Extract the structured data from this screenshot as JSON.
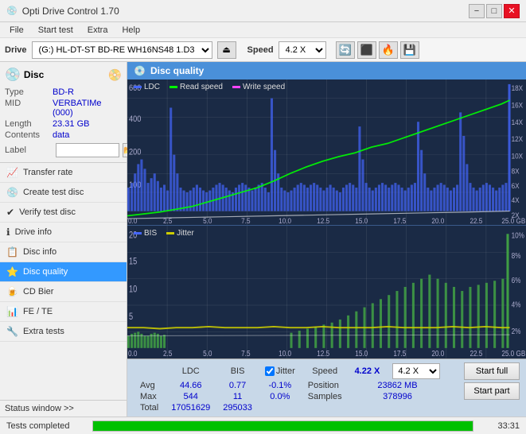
{
  "app": {
    "title": "Opti Drive Control 1.70",
    "titlebar_icon": "💿"
  },
  "titlebar": {
    "minimize": "−",
    "maximize": "□",
    "close": "✕"
  },
  "menu": {
    "items": [
      "File",
      "Start test",
      "Extra",
      "Help"
    ]
  },
  "toolbar": {
    "drive_label": "Drive",
    "drive_value": "(G:)  HL-DT-ST BD-RE  WH16NS48 1.D3",
    "speed_label": "Speed",
    "speed_value": "4.2 X"
  },
  "disc": {
    "section_title": "Disc",
    "type_label": "Type",
    "type_value": "BD-R",
    "mid_label": "MID",
    "mid_value": "VERBATIMe (000)",
    "length_label": "Length",
    "length_value": "23.31 GB",
    "contents_label": "Contents",
    "contents_value": "data",
    "label_label": "Label",
    "label_placeholder": ""
  },
  "nav": {
    "items": [
      {
        "id": "transfer-rate",
        "label": "Transfer rate",
        "icon": "📈"
      },
      {
        "id": "create-test-disc",
        "label": "Create test disc",
        "icon": "💿"
      },
      {
        "id": "verify-test-disc",
        "label": "Verify test disc",
        "icon": "✔"
      },
      {
        "id": "drive-info",
        "label": "Drive info",
        "icon": "ℹ"
      },
      {
        "id": "disc-info",
        "label": "Disc info",
        "icon": "📋"
      },
      {
        "id": "disc-quality",
        "label": "Disc quality",
        "icon": "⭐",
        "active": true
      },
      {
        "id": "cd-bier",
        "label": "CD Bier",
        "icon": "🍺"
      },
      {
        "id": "fe-te",
        "label": "FE / TE",
        "icon": "📊"
      },
      {
        "id": "extra-tests",
        "label": "Extra tests",
        "icon": "🔧"
      }
    ]
  },
  "sidebar_status": {
    "label": "Status window >>"
  },
  "disc_quality": {
    "title": "Disc quality",
    "legend": {
      "ldc": "LDC",
      "read_speed": "Read speed",
      "write_speed": "Write speed",
      "bis": "BIS",
      "jitter": "Jitter"
    },
    "chart1": {
      "y_max": 600,
      "y_right_labels": [
        "18X",
        "16X",
        "14X",
        "12X",
        "10X",
        "8X",
        "6X",
        "4X",
        "2X"
      ],
      "x_labels": [
        "0.0",
        "2.5",
        "5.0",
        "7.5",
        "10.0",
        "12.5",
        "15.0",
        "17.5",
        "20.0",
        "22.5",
        "25.0 GB"
      ]
    },
    "chart2": {
      "y_max": 20,
      "y_right_labels": [
        "10%",
        "8%",
        "6%",
        "4%",
        "2%"
      ],
      "x_labels": [
        "0.0",
        "2.5",
        "5.0",
        "7.5",
        "10.0",
        "12.5",
        "15.0",
        "17.5",
        "20.0",
        "22.5",
        "25.0 GB"
      ]
    },
    "stats": {
      "ldc_label": "LDC",
      "bis_label": "BIS",
      "jitter_label": "Jitter",
      "speed_label": "Speed",
      "speed_value": "4.22 X",
      "avg_label": "Avg",
      "avg_ldc": "44.66",
      "avg_bis": "0.77",
      "avg_jitter": "-0.1%",
      "max_label": "Max",
      "max_ldc": "544",
      "max_bis": "11",
      "max_jitter": "0.0%",
      "total_label": "Total",
      "total_ldc": "17051629",
      "total_bis": "295033",
      "position_label": "Position",
      "position_value": "23862 MB",
      "samples_label": "Samples",
      "samples_value": "378996",
      "speed_select": "4.2 X"
    },
    "buttons": {
      "start_full": "Start full",
      "start_part": "Start part"
    }
  },
  "statusbar": {
    "text": "Tests completed",
    "progress": 100,
    "time": "33:31"
  }
}
